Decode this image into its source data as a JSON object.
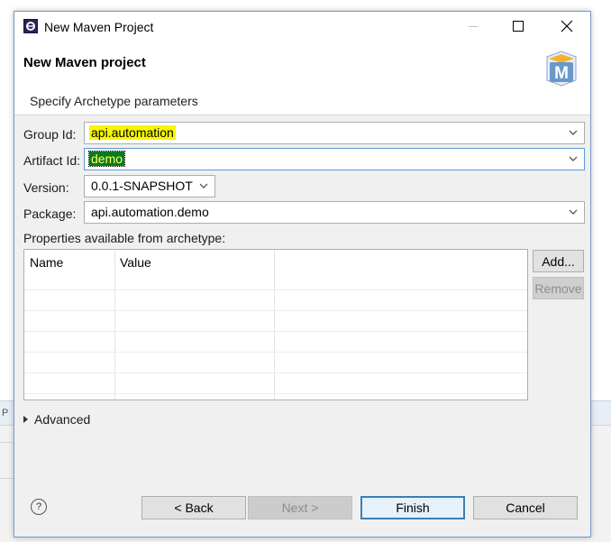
{
  "background": {
    "tab_fragment": "P"
  },
  "window": {
    "title": "New Maven Project",
    "header_title": "New Maven project",
    "header_description": "Specify Archetype parameters"
  },
  "form": {
    "group_id_label": "Group Id:",
    "group_id_value": "api.automation",
    "artifact_id_label": "Artifact Id:",
    "artifact_id_value": "demo",
    "version_label": "Version:",
    "version_value": "0.0.1-SNAPSHOT",
    "package_label": "Package:",
    "package_value": "api.automation.demo",
    "properties_label": "Properties available from archetype:"
  },
  "properties_table": {
    "columns": [
      "Name",
      "Value"
    ],
    "rows": []
  },
  "side_buttons": {
    "add": "Add...",
    "remove": "Remove"
  },
  "advanced_label": "Advanced",
  "buttons": {
    "back": "< Back",
    "next": "Next >",
    "finish": "Finish",
    "cancel": "Cancel"
  },
  "colors": {
    "highlight_yellow": "#f7f700",
    "highlight_green": "#0a7a20",
    "accent": "#3c7fb1"
  },
  "icons": [
    "eclipse-app-icon",
    "maven-logo-icon",
    "chevron-down-icon",
    "help-icon",
    "expand-arrow-icon"
  ]
}
